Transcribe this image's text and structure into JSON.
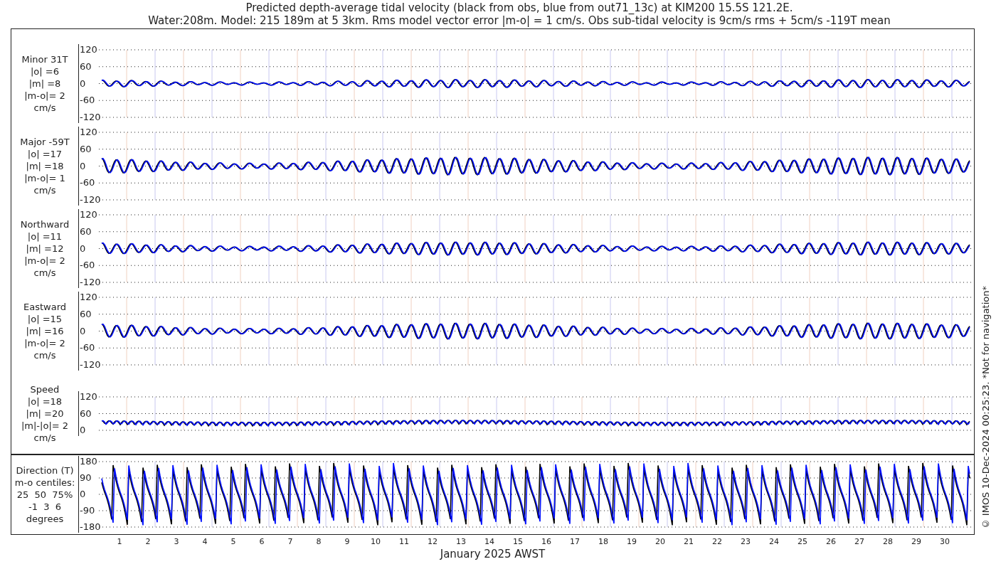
{
  "title": [
    "Predicted depth-average tidal velocity (black from obs, blue from out71_13c) at KIM200 15.5S 121.2E.",
    "Water:208m. Model: 215 189m at 5 3km. Rms model vector error |m-o| = 1 cm/s. Obs sub-tidal velocity is 9cm/s rms + 5cm/s -119T mean"
  ],
  "panels": [
    {
      "kind": "velocity",
      "label": [
        "Minor 31T",
        "|o| =6",
        "|m| =8",
        "|m-o|= 2",
        "cm/s"
      ],
      "yticks": [
        "120",
        "60",
        "0",
        "-60",
        "-120"
      ]
    },
    {
      "kind": "velocity",
      "label": [
        "Major -59T",
        "|o| =17",
        "|m| =18",
        "|m-o|= 1",
        "cm/s"
      ],
      "yticks": [
        "120",
        "60",
        "0",
        "-60",
        "-120"
      ]
    },
    {
      "kind": "velocity",
      "label": [
        "Northward",
        "|o| =11",
        "|m| =12",
        "|m-o|= 2",
        "cm/s"
      ],
      "yticks": [
        "120",
        "60",
        "0",
        "-60",
        "-120"
      ]
    },
    {
      "kind": "velocity",
      "label": [
        "Eastward",
        "|o| =15",
        "|m| =16",
        "|m-o|= 2",
        "cm/s"
      ],
      "yticks": [
        "120",
        "60",
        "0",
        "-60",
        "-120"
      ]
    },
    {
      "kind": "speed",
      "label": [
        "Speed",
        "|o| =18",
        "|m| =20",
        "|m|-|o|= 2",
        "cm/s"
      ],
      "yticks": [
        "120",
        "60",
        "0"
      ]
    },
    {
      "kind": "direction",
      "label": [
        "Direction (T)",
        "m-o centiles:",
        "25  50  75%",
        "-1  3  6",
        "degrees"
      ],
      "yticks": [
        "180",
        "90",
        "0",
        "-90",
        "-180"
      ]
    }
  ],
  "days": [
    "1",
    "2",
    "3",
    "4",
    "5",
    "6",
    "7",
    "8",
    "9",
    "10",
    "11",
    "12",
    "13",
    "14",
    "15",
    "16",
    "17",
    "18",
    "19",
    "20",
    "21",
    "22",
    "23",
    "24",
    "25",
    "26",
    "27",
    "28",
    "29",
    "30"
  ],
  "xlabel": "January 2025 AWST",
  "credit": "© IMOS 10-Dec-2024 00:25:23. *Not for navigation*"
}
